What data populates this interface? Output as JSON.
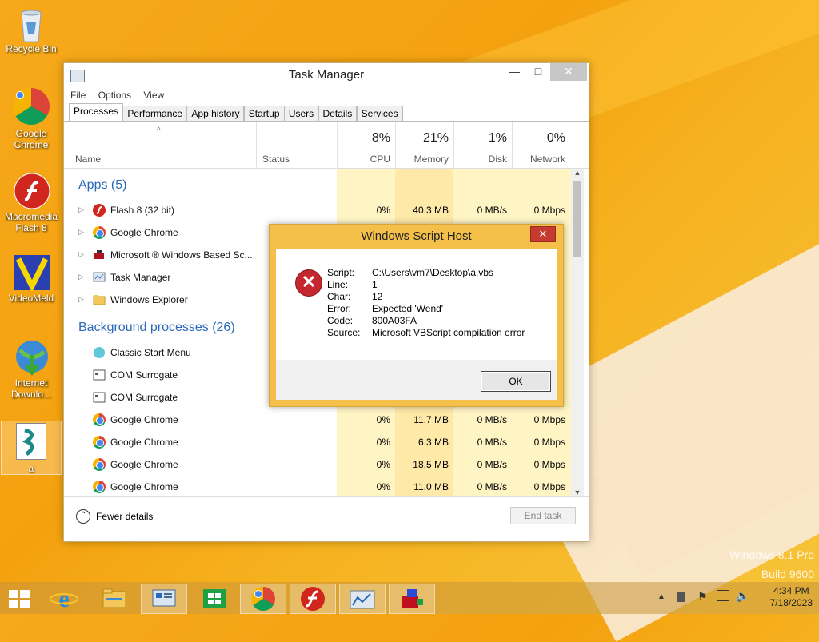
{
  "desktop": {
    "icons": [
      {
        "label": "Recycle Bin"
      },
      {
        "label": "Google Chrome"
      },
      {
        "label": "Macromedia Flash 8"
      },
      {
        "label": "VideoMeld"
      },
      {
        "label": "Internet Downlo..."
      },
      {
        "label": "a"
      }
    ],
    "watermark": {
      "line1": "Windows 8.1 Pro",
      "line2": "Build 9600"
    }
  },
  "task_manager": {
    "title": "Task Manager",
    "menu": [
      "File",
      "Options",
      "View"
    ],
    "tabs": [
      "Processes",
      "Performance",
      "App history",
      "Startup",
      "Users",
      "Details",
      "Services"
    ],
    "columns": {
      "name": "Name",
      "status": "Status",
      "cpu": {
        "pct": "8%",
        "label": "CPU"
      },
      "memory": {
        "pct": "21%",
        "label": "Memory"
      },
      "disk": {
        "pct": "1%",
        "label": "Disk"
      },
      "network": {
        "pct": "0%",
        "label": "Network"
      }
    },
    "groups": {
      "apps": "Apps (5)",
      "background": "Background processes (26)"
    },
    "rows": [
      {
        "name": "Flash 8 (32 bit)",
        "cpu": "0%",
        "mem": "40.3 MB",
        "disk": "0 MB/s",
        "net": "0 Mbps"
      },
      {
        "name": "Google Chrome",
        "cpu": "",
        "mem": "",
        "disk": "",
        "net": ""
      },
      {
        "name": "Microsoft ® Windows Based Sc...",
        "cpu": "",
        "mem": "",
        "disk": "",
        "net": ""
      },
      {
        "name": "Task Manager",
        "cpu": "",
        "mem": "",
        "disk": "",
        "net": ""
      },
      {
        "name": "Windows Explorer",
        "cpu": "",
        "mem": "",
        "disk": "",
        "net": ""
      },
      {
        "name": "Classic Start Menu",
        "cpu": "",
        "mem": "",
        "disk": "",
        "net": ""
      },
      {
        "name": "COM Surrogate",
        "cpu": "",
        "mem": "",
        "disk": "",
        "net": ""
      },
      {
        "name": "COM Surrogate",
        "cpu": "",
        "mem": "",
        "disk": "",
        "net": ""
      },
      {
        "name": "Google Chrome",
        "cpu": "0%",
        "mem": "11.7 MB",
        "disk": "0 MB/s",
        "net": "0 Mbps"
      },
      {
        "name": "Google Chrome",
        "cpu": "0%",
        "mem": "6.3 MB",
        "disk": "0 MB/s",
        "net": "0 Mbps"
      },
      {
        "name": "Google Chrome",
        "cpu": "0%",
        "mem": "18.5 MB",
        "disk": "0 MB/s",
        "net": "0 Mbps"
      },
      {
        "name": "Google Chrome",
        "cpu": "0%",
        "mem": "11.0 MB",
        "disk": "0 MB/s",
        "net": "0 Mbps"
      }
    ],
    "footer": {
      "fewer": "Fewer details",
      "end_task": "End task"
    }
  },
  "dialog": {
    "title": "Windows Script Host",
    "fields": [
      {
        "k": "Script:",
        "v": "C:\\Users\\vm7\\Desktop\\a.vbs"
      },
      {
        "k": "Line:",
        "v": "1"
      },
      {
        "k": "Char:",
        "v": "12"
      },
      {
        "k": "Error:",
        "v": "Expected 'Wend'"
      },
      {
        "k": "Code:",
        "v": "800A03FA"
      },
      {
        "k": "Source:",
        "v": "Microsoft VBScript compilation error"
      }
    ],
    "ok": "OK"
  },
  "taskbar": {
    "time": "4:34 PM",
    "date": "7/18/2023"
  }
}
